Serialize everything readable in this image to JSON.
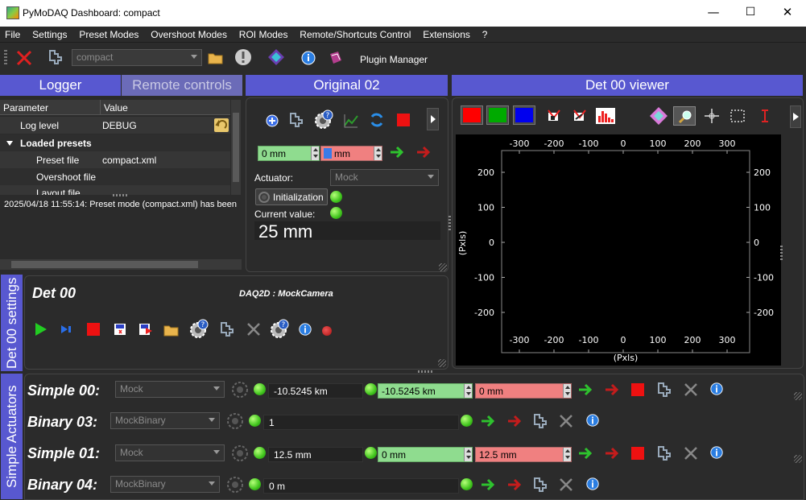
{
  "window": {
    "title": "PyMoDAQ Dashboard: compact",
    "minimize": "—",
    "maximize": "☐",
    "close": "✕"
  },
  "menu": [
    "File",
    "Settings",
    "Preset Modes",
    "Overshoot Modes",
    "ROI Modes",
    "Remote/Shortcuts Control",
    "Extensions",
    "?"
  ],
  "toolbar": {
    "preset_combo": "compact",
    "plugin_manager": "Plugin Manager"
  },
  "docks": {
    "logger": "Logger",
    "remote": "Remote controls",
    "original": "Original 02",
    "det_viewer": "Det 00 viewer",
    "det_settings": "Det 00 settings",
    "simple_actuators": "Simple Actuators"
  },
  "param_table": {
    "header_param": "Parameter",
    "header_value": "Value",
    "log_level_k": "Log level",
    "log_level_v": "DEBUG",
    "loaded_presets": "Loaded presets",
    "preset_file_k": "Preset file",
    "preset_file_v": "compact.xml",
    "overshoot_file_k": "Overshoot file",
    "layout_file_k": "Layout file"
  },
  "log_line": "2025/04/18 11:55:14: Preset mode (compact.xml) has been",
  "original": {
    "pos_green": "0 mm",
    "pos_red": "mm",
    "actuator_label": "Actuator:",
    "actuator_value": "Mock",
    "init_label": "Initialization",
    "current_label": "Current value:",
    "current_value": "25 mm"
  },
  "viewer": {
    "x_ticks": [
      "-300",
      "-200",
      "-100",
      "0",
      "100",
      "200",
      "300"
    ],
    "y_ticks": [
      "200",
      "100",
      "0",
      "-100",
      "-200"
    ],
    "xlabel": "(Pxls)",
    "ylabel": "(Pxls)"
  },
  "det": {
    "name": "Det 00",
    "type": "DAQ2D : MockCamera"
  },
  "actuators": [
    {
      "name": "Simple 00:",
      "plugin": "Mock",
      "value": "-10.5245 km",
      "green": "-10.5245 km",
      "red": "0 mm"
    },
    {
      "name": "Binary 03:",
      "plugin": "MockBinary",
      "value": "1"
    },
    {
      "name": "Simple 01:",
      "plugin": "Mock",
      "value": "12.5 mm",
      "green": "0 mm",
      "red": "12.5 mm"
    },
    {
      "name": "Binary 04:",
      "plugin": "MockBinary",
      "value": "0 m"
    }
  ],
  "colors": {
    "dock_blue": "#5858d0",
    "led_green": "#3fc41c",
    "input_green": "#8fdc8f",
    "input_red": "#f08080"
  }
}
